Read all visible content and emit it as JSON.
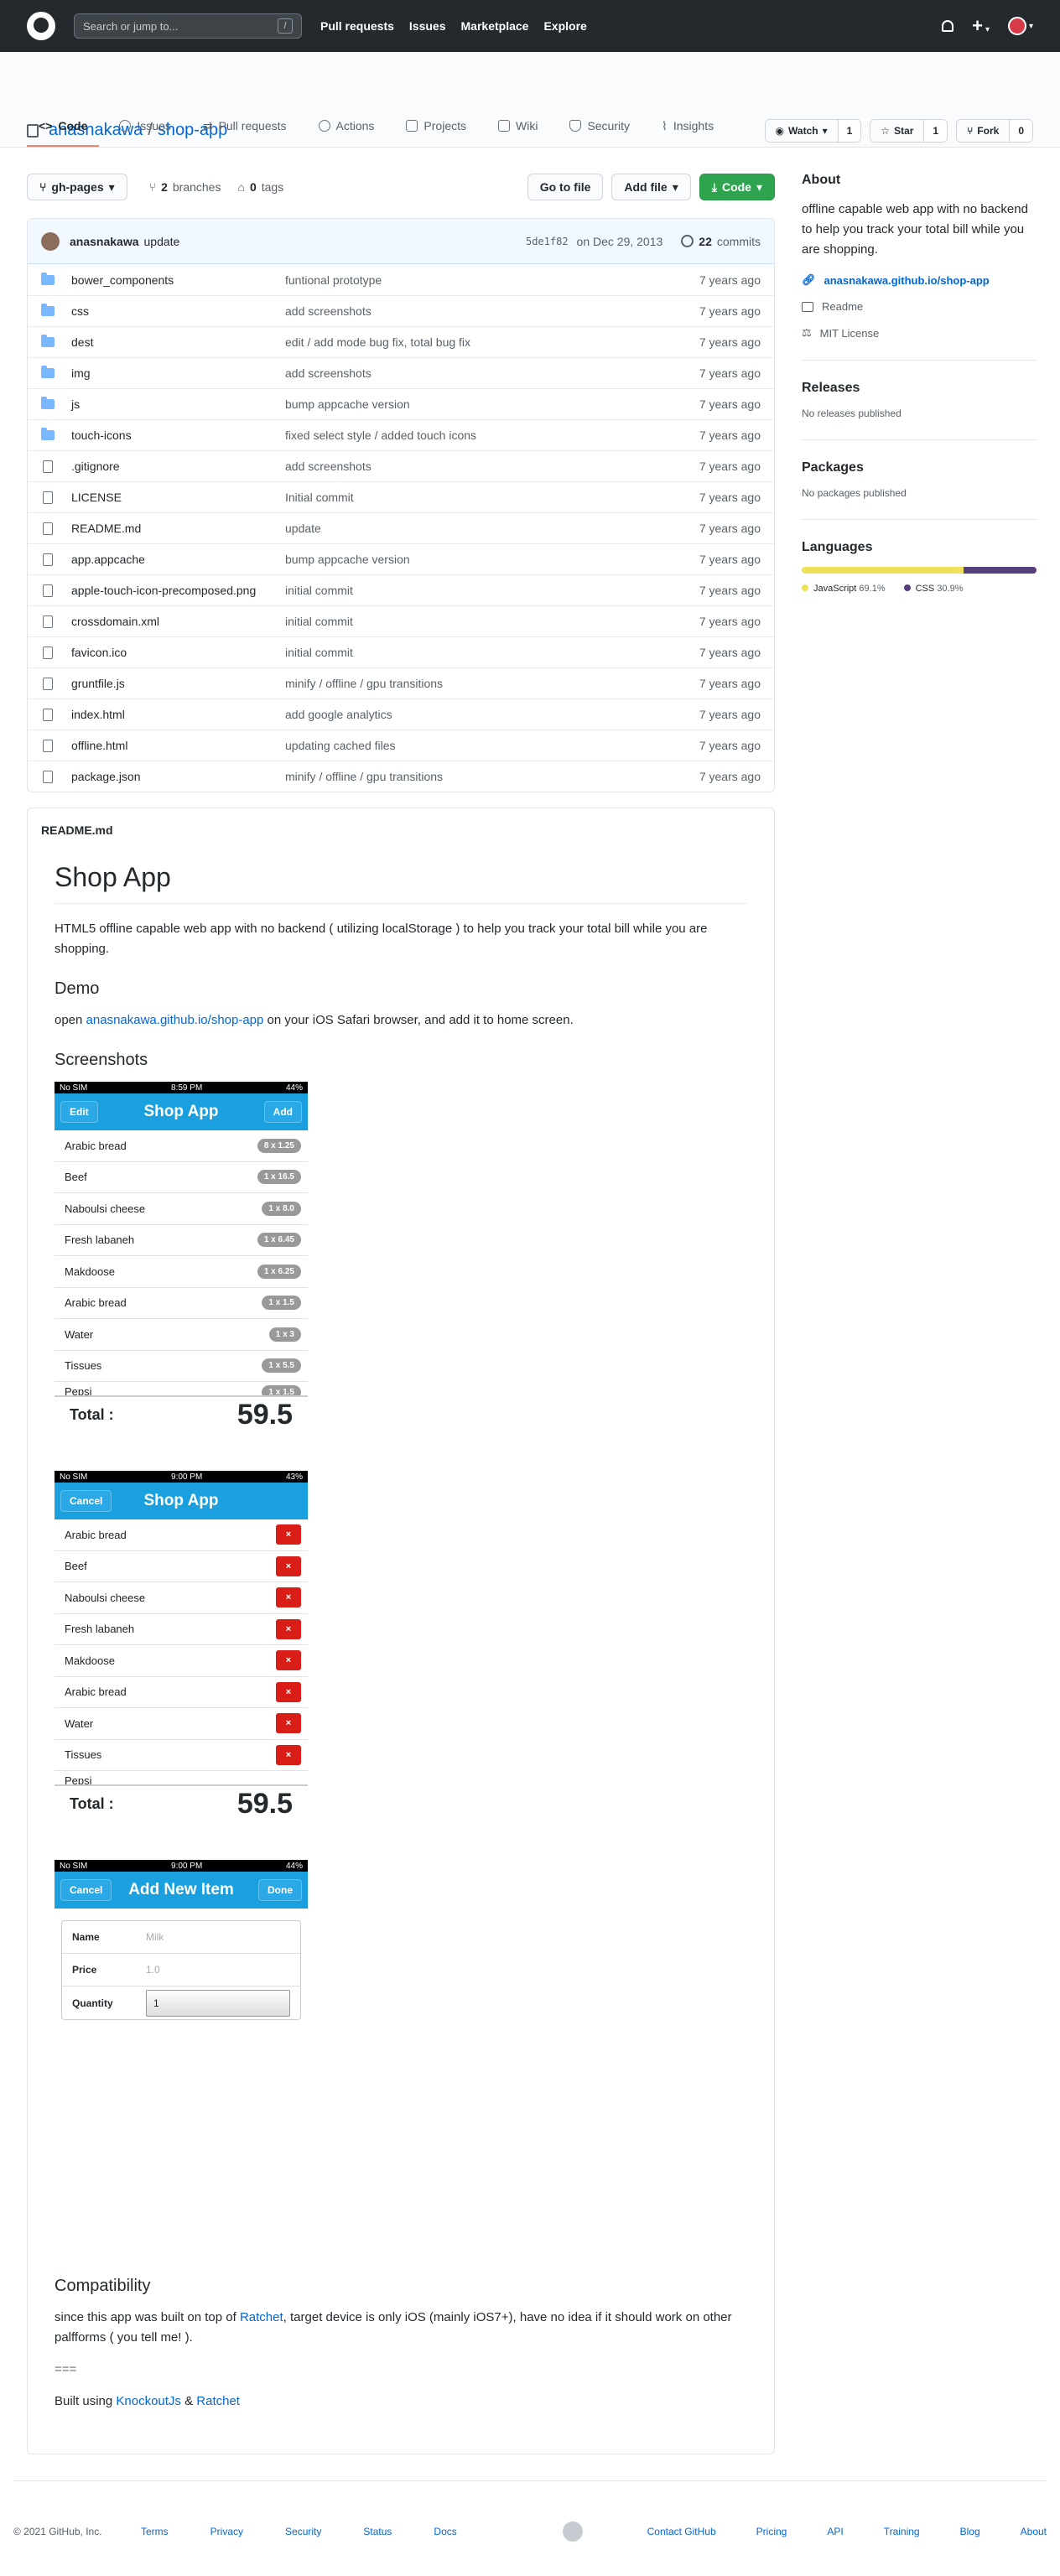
{
  "topbar": {
    "search_placeholder": "Search or jump to...",
    "slash_key": "/",
    "nav": [
      "Pull requests",
      "Issues",
      "Marketplace",
      "Explore"
    ]
  },
  "repo": {
    "owner": "anasnakawa",
    "separator": "/",
    "name": "shop-app",
    "watch_label": "Watch",
    "watch_count": "1",
    "star_label": "Star",
    "star_count": "1",
    "fork_label": "Fork",
    "fork_count": "0"
  },
  "tabs": [
    {
      "label": "Code",
      "icon": "code-icon"
    },
    {
      "label": "Issues",
      "icon": "issue-icon"
    },
    {
      "label": "Pull requests",
      "icon": "pull-request-icon"
    },
    {
      "label": "Actions",
      "icon": "play-icon"
    },
    {
      "label": "Projects",
      "icon": "project-icon"
    },
    {
      "label": "Wiki",
      "icon": "book-icon"
    },
    {
      "label": "Security",
      "icon": "shield-icon"
    },
    {
      "label": "Insights",
      "icon": "graph-icon"
    }
  ],
  "controls": {
    "branch": "gh-pages",
    "branches_count": "2",
    "branches_label": "branches",
    "tags_count": "0",
    "tags_label": "tags",
    "goto_file": "Go to file",
    "add_file": "Add file",
    "code": "Code"
  },
  "commit": {
    "author": "anasnakawa",
    "message": "update",
    "sha": "5de1f82",
    "date": "on Dec 29, 2013",
    "count": "22",
    "count_label": "commits"
  },
  "files": [
    {
      "name": "bower_components",
      "type": "dir",
      "message": "funtional prototype",
      "age": "7 years ago"
    },
    {
      "name": "css",
      "type": "dir",
      "message": "add screenshots",
      "age": "7 years ago"
    },
    {
      "name": "dest",
      "type": "dir",
      "message": "edit / add mode bug fix, total bug fix",
      "age": "7 years ago"
    },
    {
      "name": "img",
      "type": "dir",
      "message": "add screenshots",
      "age": "7 years ago"
    },
    {
      "name": "js",
      "type": "dir",
      "message": "bump appcache version",
      "age": "7 years ago"
    },
    {
      "name": "touch-icons",
      "type": "dir",
      "message": "fixed select style / added touch icons",
      "age": "7 years ago"
    },
    {
      "name": ".gitignore",
      "type": "file",
      "message": "add screenshots",
      "age": "7 years ago"
    },
    {
      "name": "LICENSE",
      "type": "file",
      "message": "Initial commit",
      "age": "7 years ago"
    },
    {
      "name": "README.md",
      "type": "file",
      "message": "update",
      "age": "7 years ago"
    },
    {
      "name": "app.appcache",
      "type": "file",
      "message": "bump appcache version",
      "age": "7 years ago"
    },
    {
      "name": "apple-touch-icon-precomposed.png",
      "type": "file",
      "message": "initial commit",
      "age": "7 years ago"
    },
    {
      "name": "crossdomain.xml",
      "type": "file",
      "message": "initial commit",
      "age": "7 years ago"
    },
    {
      "name": "favicon.ico",
      "type": "file",
      "message": "initial commit",
      "age": "7 years ago"
    },
    {
      "name": "gruntfile.js",
      "type": "file",
      "message": "minify / offline / gpu transitions",
      "age": "7 years ago"
    },
    {
      "name": "index.html",
      "type": "file",
      "message": "add google analytics",
      "age": "7 years ago"
    },
    {
      "name": "offline.html",
      "type": "file",
      "message": "updating cached files",
      "age": "7 years ago"
    },
    {
      "name": "package.json",
      "type": "file",
      "message": "minify / offline / gpu transitions",
      "age": "7 years ago"
    }
  ],
  "readme": {
    "filename": "README.md",
    "title": "Shop App",
    "intro": "HTML5 offline capable web app with no backend ( utilizing localStorage ) to help you track your total bill while you are shopping.",
    "demo_heading": "Demo",
    "demo_prefix": "open ",
    "demo_link": "anasnakawa.github.io/shop-app",
    "demo_suffix": " on your iOS Safari browser, and add it to home screen.",
    "screenshots_heading": "Screenshots",
    "compat_heading": "Compatibility",
    "compat_prefix": "since this app was built on top of ",
    "compat_link": "Ratchet",
    "compat_suffix": ", target device is only iOS (mainly iOS7+), have no idea if it should work on other palfforms ( you tell me! ).",
    "hr_text": "===",
    "built_prefix": "Built using ",
    "built_link1": "KnockoutJs",
    "built_amp": " & ",
    "built_link2": "Ratchet"
  },
  "phone1": {
    "carrier": "No SIM",
    "time": "8:59 PM",
    "battery": "44%",
    "left_btn": "Edit",
    "title": "Shop App",
    "right_btn": "Add",
    "items": [
      {
        "name": "Arabic bread",
        "qty": "8 x 1.25"
      },
      {
        "name": "Beef",
        "qty": "1 x 16.5"
      },
      {
        "name": "Naboulsi cheese",
        "qty": "1 x 8.0"
      },
      {
        "name": "Fresh labaneh",
        "qty": "1 x 6.45"
      },
      {
        "name": "Makdoose",
        "qty": "1 x 6.25"
      },
      {
        "name": "Arabic bread",
        "qty": "1 x 1.5"
      },
      {
        "name": "Water",
        "qty": "1 x 3"
      },
      {
        "name": "Tissues",
        "qty": "1 x 5.5"
      },
      {
        "name": "Pepsi",
        "qty": "1 x 1.5"
      }
    ],
    "total_label": "Total :",
    "total_value": "59.5"
  },
  "phone2": {
    "carrier": "No SIM",
    "time": "9:00 PM",
    "battery": "43%",
    "left_btn": "Cancel",
    "title": "Shop App",
    "delete_glyph": "×",
    "items": [
      "Arabic bread",
      "Beef",
      "Naboulsi cheese",
      "Fresh labaneh",
      "Makdoose",
      "Arabic bread",
      "Water",
      "Tissues",
      "Pepsi"
    ],
    "total_label": "Total :",
    "total_value": "59.5"
  },
  "phone3": {
    "carrier": "No SIM",
    "time": "9:00 PM",
    "battery": "44%",
    "left_btn": "Cancel",
    "title": "Add New Item",
    "right_btn": "Done",
    "name_label": "Name",
    "name_placeholder": "Milk",
    "price_label": "Price",
    "price_placeholder": "1.0",
    "qty_label": "Quantity",
    "qty_value": "1"
  },
  "sidebar": {
    "about_heading": "About",
    "about_text": "offline capable web app with no backend to help you track your total bill while you are shopping.",
    "website": "anasnakawa.github.io/shop-app",
    "readme": "Readme",
    "license": "MIT License",
    "releases_heading": "Releases",
    "releases_text": "No releases published",
    "packages_heading": "Packages",
    "packages_text": "No packages published",
    "languages_heading": "Languages",
    "languages": [
      {
        "name": "JavaScript",
        "percent": "69.1%",
        "color": "#f1e05a",
        "fraction": 0.691
      },
      {
        "name": "CSS",
        "percent": "30.9%",
        "color": "#563d7c",
        "fraction": 0.309
      }
    ]
  },
  "footer": {
    "copyright": "© 2021 GitHub, Inc.",
    "left_links": [
      "Terms",
      "Privacy",
      "Security",
      "Status",
      "Docs"
    ],
    "right_links": [
      "Contact GitHub",
      "Pricing",
      "API",
      "Training",
      "Blog",
      "About"
    ]
  }
}
